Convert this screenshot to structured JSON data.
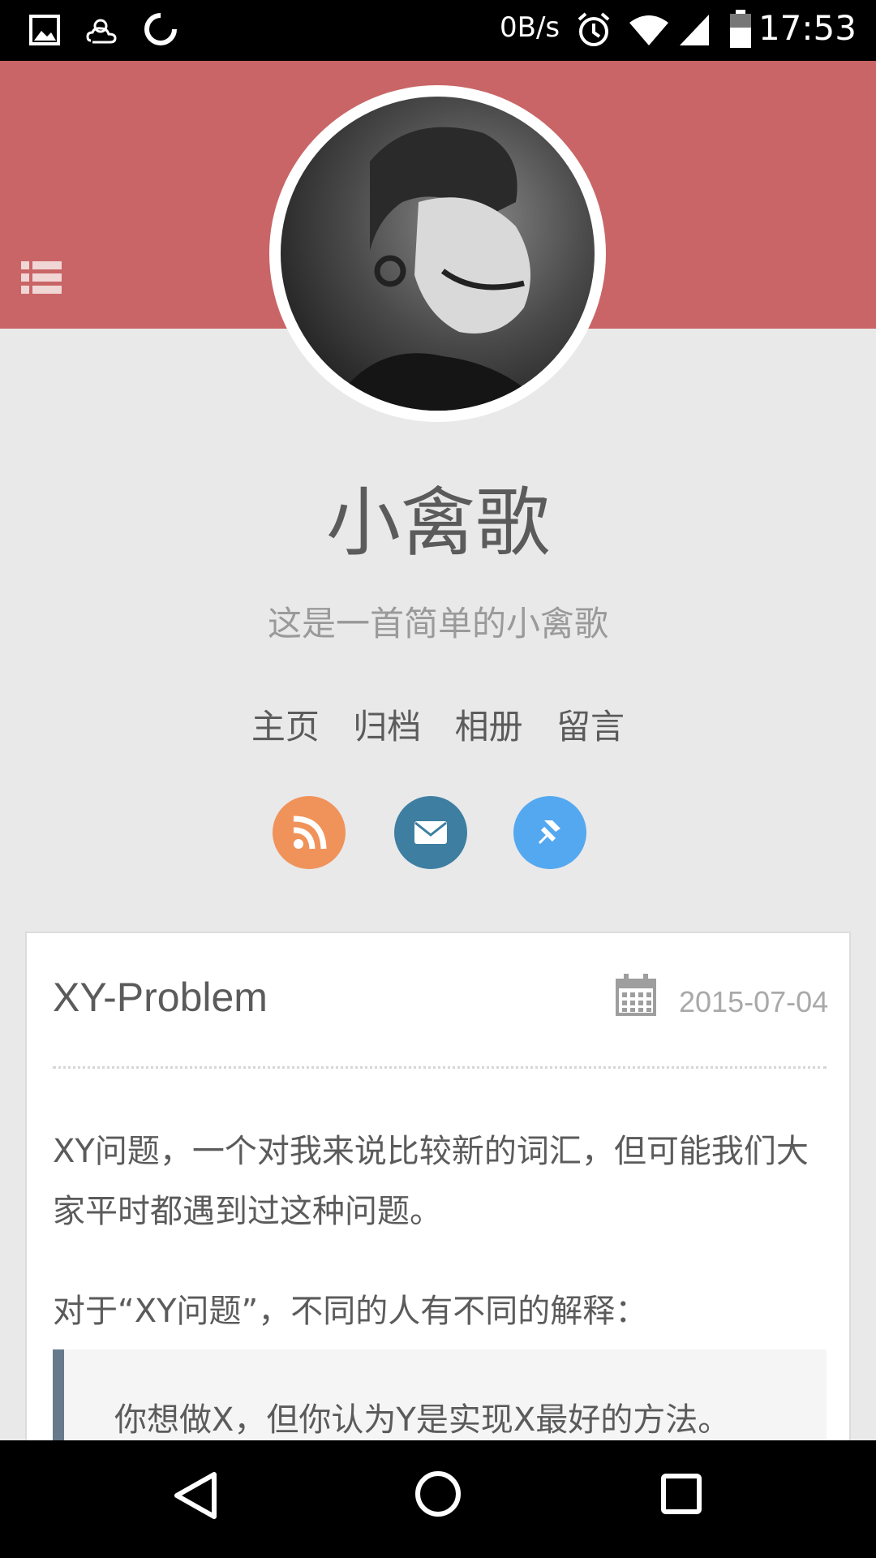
{
  "status_bar": {
    "net_speed": "0B/s",
    "time": "17:53",
    "icons": [
      "image-icon",
      "weather-icon",
      "sync-icon",
      "alarm-icon",
      "wifi-icon",
      "signal-icon",
      "battery-icon"
    ]
  },
  "header": {
    "color": "#c96566",
    "menu_icon": "list-menu-icon"
  },
  "profile": {
    "name": "小禽歌",
    "subtitle": "这是一首简单的小禽歌"
  },
  "nav": {
    "items": [
      {
        "label": "主页"
      },
      {
        "label": "归档"
      },
      {
        "label": "相册"
      },
      {
        "label": "留言"
      }
    ]
  },
  "social": [
    {
      "icon": "rss-icon",
      "color": "#f0935a"
    },
    {
      "icon": "mail-icon",
      "color": "#3e7fa1"
    },
    {
      "icon": "pin-icon",
      "color": "#54a8f0"
    }
  ],
  "post": {
    "title": "XY-Problem",
    "date": "2015-07-04",
    "para1": "XY问题，一个对我来说比较新的词汇，但可能我们大家平时都遇到过这种问题。",
    "para2": "对于“XY问题”，不同的人有不同的解释：",
    "quote": "你想做X，但你认为Y是实现X最好的方法。"
  },
  "system_nav": [
    "back-icon",
    "home-icon",
    "recents-icon"
  ]
}
